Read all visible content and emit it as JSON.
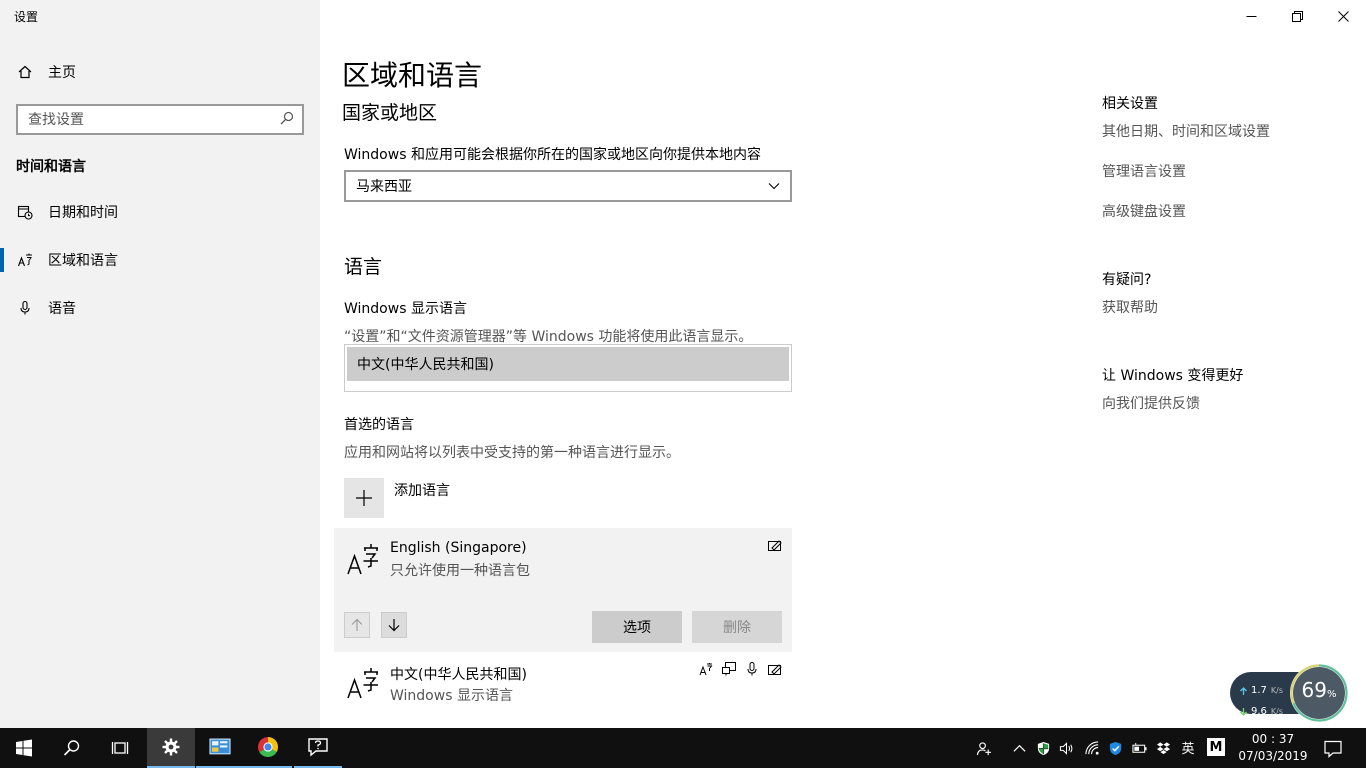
{
  "app": {
    "title": "设置"
  },
  "sidebar": {
    "home_label": "主页",
    "search_placeholder": "查找设置",
    "section_label": "时间和语言",
    "items": [
      {
        "label": "日期和时间",
        "icon": "calendar-clock-icon"
      },
      {
        "label": "区域和语言",
        "icon": "language-icon"
      },
      {
        "label": "语音",
        "icon": "microphone-icon"
      }
    ]
  },
  "page": {
    "title": "区域和语言",
    "country": {
      "heading": "国家或地区",
      "description": "Windows 和应用可能会根据你所在的国家或地区向你提供本地内容",
      "selected": "马来西亚"
    },
    "language": {
      "heading": "语言",
      "display_label": "Windows 显示语言",
      "display_desc": "“设置”和“文件资源管理器”等 Windows 功能将使用此语言显示。",
      "display_selected": "中文(中华人民共和国)",
      "preferred_label": "首选的语言",
      "preferred_desc": "应用和网站将以列表中受支持的第一种语言进行显示。",
      "add_label": "添加语言",
      "languages": [
        {
          "name": "English (Singapore)",
          "sub": "只允许使用一种语言包"
        },
        {
          "name": "中文(中华人民共和国)",
          "sub": "Windows 显示语言"
        }
      ],
      "options_label": "选项",
      "remove_label": "删除"
    }
  },
  "related": {
    "heading": "相关设置",
    "links": [
      "其他日期、时间和区域设置",
      "管理语言设置",
      "高级键盘设置"
    ],
    "question_heading": "有疑问?",
    "question_link": "获取帮助",
    "better_heading": "让 Windows 变得更好",
    "better_link": "向我们提供反馈"
  },
  "speed_widget": {
    "up": "1.7",
    "down": "9.6",
    "unit": "K/s",
    "percent": "69",
    "percent_sign": "%"
  },
  "taskbar": {
    "ime": "英",
    "tray_m": "M",
    "time": "00 : 37",
    "date": "07/03/2019"
  },
  "colors": {
    "accent": "#0063b1",
    "sidebar_bg": "#f2f2f2",
    "taskbar_bg": "#101010"
  }
}
